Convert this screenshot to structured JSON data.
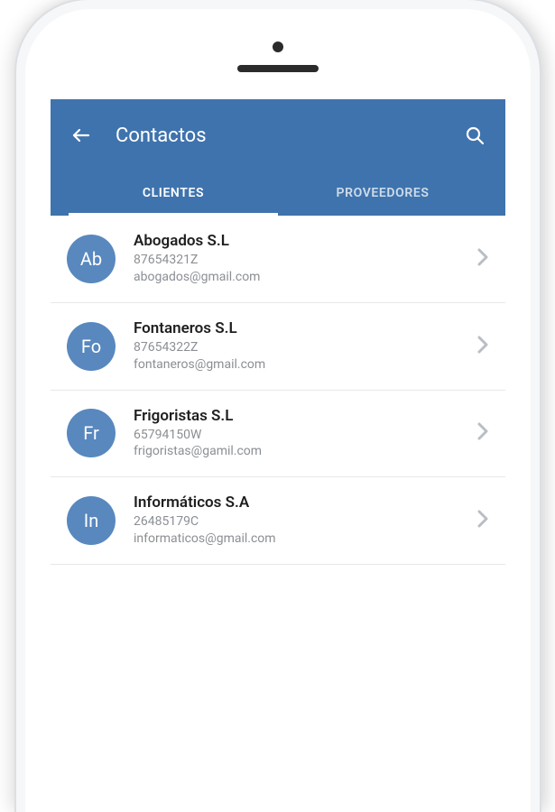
{
  "header": {
    "title": "Contactos"
  },
  "tabs": [
    {
      "label": "CLIENTES",
      "active": true
    },
    {
      "label": "PROVEEDORES",
      "active": false
    }
  ],
  "contacts": [
    {
      "initials": "Ab",
      "name": "Abogados S.L",
      "code": "87654321Z",
      "email": "abogados@gmail.com"
    },
    {
      "initials": "Fo",
      "name": "Fontaneros S.L",
      "code": "87654322Z",
      "email": "fontaneros@gmail.com"
    },
    {
      "initials": "Fr",
      "name": "Frigoristas S.L",
      "code": "65794150W",
      "email": "frigoristas@gamil.com"
    },
    {
      "initials": "In",
      "name": "Informáticos S.A",
      "code": "26485179C",
      "email": "informaticos@gmail.com"
    }
  ],
  "colors": {
    "header_bg": "#3f73ad",
    "avatar_bg": "#5888be"
  }
}
